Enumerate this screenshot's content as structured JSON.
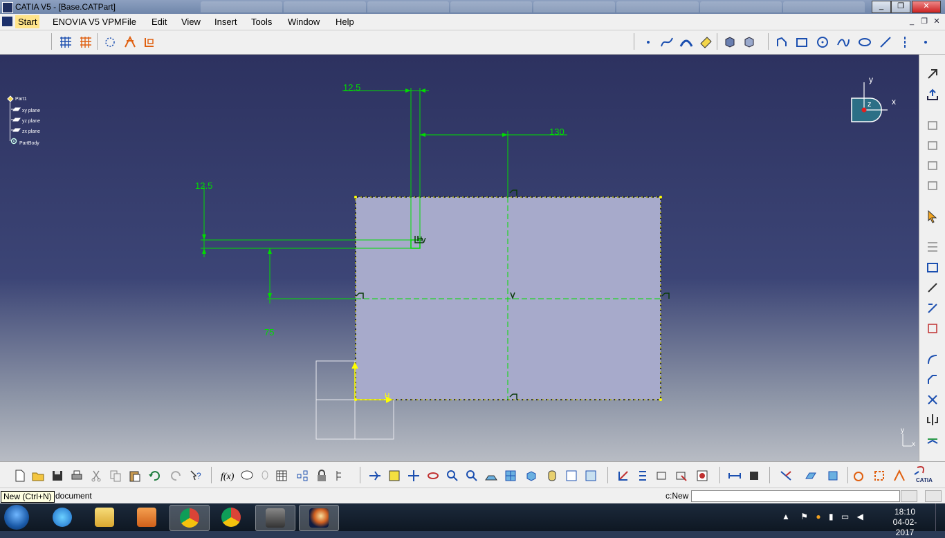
{
  "window": {
    "title": "CATIA V5 - [Base.CATPart]",
    "minimize": "_",
    "restore": "❐",
    "close": "✕"
  },
  "menubar": {
    "items": [
      "Start",
      "ENOVIA V5 VPM",
      "File",
      "Edit",
      "View",
      "Insert",
      "Tools",
      "Window",
      "Help"
    ],
    "mdi_min": "_",
    "mdi_restore": "❐",
    "mdi_close": "✕"
  },
  "spec_tree": {
    "root": "Part1",
    "children": [
      "xy plane",
      "yz plane",
      "zx plane",
      "PartBody"
    ]
  },
  "compass": {
    "x": "x",
    "y": "y",
    "z": "z"
  },
  "sketch": {
    "dimensions": {
      "top_offset": "12.5",
      "horizontal_offset": "130",
      "left_offset": "12.5",
      "vertical_offset": "75"
    },
    "axis_h": "H",
    "axis_v": "V"
  },
  "axis_triad": {
    "x": "x",
    "y": "y"
  },
  "statusbar": {
    "tooltip": "New (Ctrl+N)",
    "message": "document",
    "command_label": "c:New",
    "command_value": ""
  },
  "taskbar": {
    "time": "18:10",
    "date": "04-02-2017"
  },
  "colors": {
    "sketch_green": "#00ff00",
    "sketch_fill": "#a7aacb",
    "profile_yellow": "#ffff00"
  }
}
